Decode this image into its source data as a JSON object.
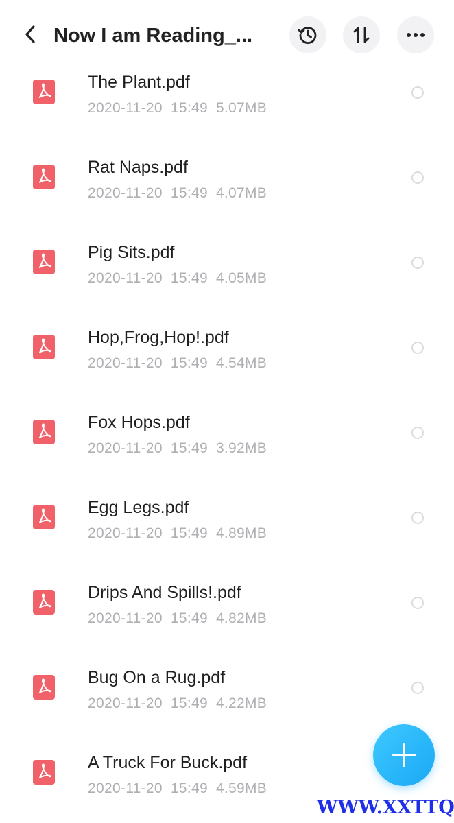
{
  "header": {
    "title": "Now I am Reading_...",
    "back_icon": "chevron-left-icon",
    "history_icon": "history-icon",
    "sort_icon": "sort-icon",
    "more_icon": "more-horizontal-icon"
  },
  "files": [
    {
      "name": "The Plant.pdf",
      "date": "2020-11-20",
      "time": "15:49",
      "size": "5.07MB"
    },
    {
      "name": "Rat Naps.pdf",
      "date": "2020-11-20",
      "time": "15:49",
      "size": "4.07MB"
    },
    {
      "name": "Pig Sits.pdf",
      "date": "2020-11-20",
      "time": "15:49",
      "size": "4.05MB"
    },
    {
      "name": "Hop,Frog,Hop!.pdf",
      "date": "2020-11-20",
      "time": "15:49",
      "size": "4.54MB"
    },
    {
      "name": "Fox Hops.pdf",
      "date": "2020-11-20",
      "time": "15:49",
      "size": "3.92MB"
    },
    {
      "name": "Egg Legs.pdf",
      "date": "2020-11-20",
      "time": "15:49",
      "size": "4.89MB"
    },
    {
      "name": "Drips And Spills!.pdf",
      "date": "2020-11-20",
      "time": "15:49",
      "size": "4.82MB"
    },
    {
      "name": "Bug On a Rug.pdf",
      "date": "2020-11-20",
      "time": "15:49",
      "size": "4.22MB"
    },
    {
      "name": "A Truck For Buck.pdf",
      "date": "2020-11-20",
      "time": "15:49",
      "size": "4.59MB"
    }
  ],
  "fab": {
    "icon": "plus-icon"
  },
  "watermark": {
    "text": "WWW.XXTTQ.COM"
  },
  "colors": {
    "pdf_icon": "#f0616a",
    "fab": "#1aa8f5",
    "watermark": "#1f2fe8",
    "meta_text": "#b0b0b4"
  }
}
